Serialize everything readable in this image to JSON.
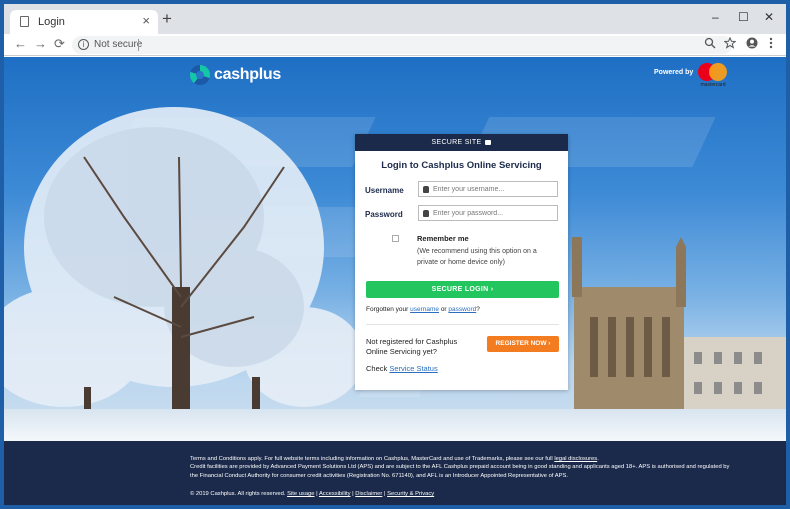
{
  "browser": {
    "tab_title": "Login",
    "new_tab": "+",
    "tab_close": "×",
    "window_controls": {
      "minimize": "–",
      "maximize": "☐",
      "close": "✕"
    },
    "nav": {
      "back": "←",
      "forward": "→",
      "reload": "⟳"
    },
    "omnibox": {
      "security_label": "Not secure",
      "info_glyph": "i"
    },
    "toolbar_icons": [
      "zoom-icon",
      "bookmark-star-icon",
      "account-icon",
      "menu-kebab-icon"
    ]
  },
  "page": {
    "logo_text": "cashplus",
    "powered_by": "Powered by",
    "mastercard_text": "mastercard",
    "colors": {
      "navy": "#1b2a4a",
      "green": "#22c55e",
      "orange": "#f47c20",
      "link": "#2a6fc0"
    }
  },
  "login": {
    "header": "SECURE SITE",
    "title": "Login to Cashplus Online Servicing",
    "username_label": "Username",
    "username_placeholder": "Enter your username...",
    "password_label": "Password",
    "password_placeholder": "Enter your password...",
    "remember_label": "Remember me",
    "remember_note": "(We recommend using this option on a private or home device only)",
    "submit": "SECURE LOGIN",
    "forgot_prefix": "Forgotten your",
    "forgot_username": "username",
    "forgot_or": "or",
    "forgot_password": "password",
    "forgot_suffix": "?",
    "not_registered": "Not registered for Cashplus Online Servicing yet?",
    "register": "REGISTER NOW",
    "check_prefix": "Check",
    "service_status": "Service Status"
  },
  "footer": {
    "line1_prefix": "Terms and Conditions apply. For full website terms including information on Cashplus, MasterCard and use of Trademarks, please see our full",
    "line1_link": "legal disclosures",
    "line1_suffix": ".",
    "line2": "Credit facilities are provided by Advanced Payment Solutions Ltd (APS) and are subject to the AFL Cashplus prepaid account being in good standing and applicants aged 18+. APS is authorised and regulated by the Financial Conduct Authority for consumer credit activities (Registration No. 671140), and AFL is an Introducer Appointed Representative of APS.",
    "copyright": "© 2019 Cashplus. All rights reserved.",
    "links": [
      "Site usage",
      "Accessibility",
      "Disclaimer",
      "Security & Privacy"
    ],
    "link_sep": "|"
  }
}
